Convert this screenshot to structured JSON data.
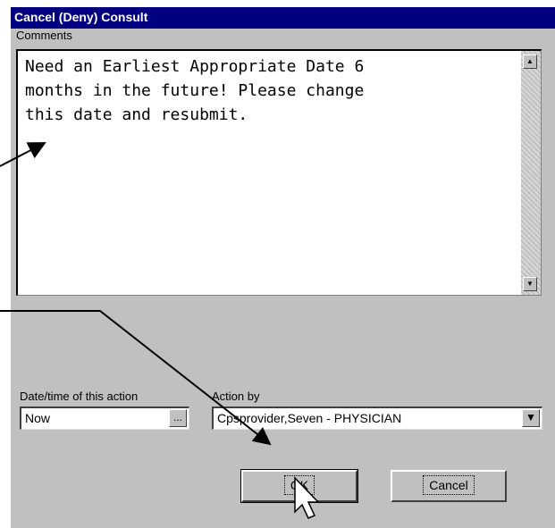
{
  "dialog": {
    "title": "Cancel (Deny) Consult",
    "comments_label": "Comments",
    "comments_text": "Need an Earliest Appropriate Date 6\nmonths in the future! Please change\nthis date and resubmit.",
    "date_label": "Date/time of this action",
    "date_value": "Now",
    "date_button": "...",
    "actby_label": "Action by",
    "actby_value": "Cpsprovider,Seven - PHYSICIAN",
    "ok_label": "OK",
    "cancel_label": "Cancel"
  },
  "colors": {
    "titlebar": "#000080",
    "dialog_bg": "#c0c0c0",
    "arrow": "#000000"
  }
}
